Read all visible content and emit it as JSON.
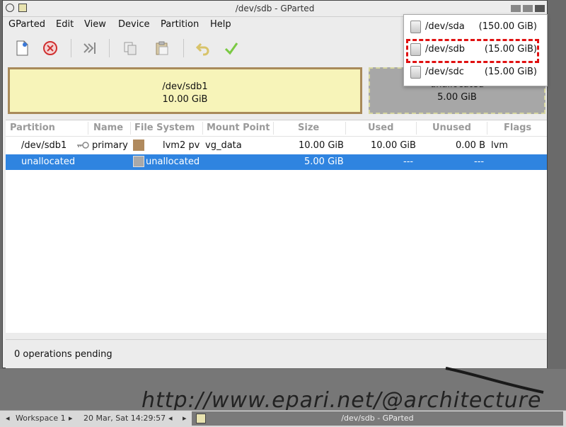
{
  "window": {
    "title": "/dev/sdb - GParted"
  },
  "menu": [
    "GParted",
    "Edit",
    "View",
    "Device",
    "Partition",
    "Help"
  ],
  "toolbar_icons": [
    "new-partition-icon",
    "delete-partition-icon",
    "resize-move-icon",
    "copy-icon",
    "paste-icon",
    "undo-icon",
    "apply-icon"
  ],
  "diskmap": {
    "part1_name": "/dev/sdb1",
    "part1_size": "10.00 GiB",
    "unalloc_name": "unallocated",
    "unalloc_size": "5.00 GiB"
  },
  "columns": [
    "Partition",
    "Name",
    "File System",
    "Mount Point",
    "Size",
    "Used",
    "Unused",
    "Flags"
  ],
  "rows": [
    {
      "partition": "/dev/sdb1",
      "name": "primary",
      "fs": "lvm2 pv",
      "mount": "vg_data",
      "size": "10.00 GiB",
      "used": "10.00 GiB",
      "unused": "0.00 B",
      "flags": "lvm",
      "color": "#b08a5e"
    },
    {
      "partition": "unallocated",
      "name": "",
      "fs": "unallocated",
      "mount": "",
      "size": "5.00 GiB",
      "used": "---",
      "unused": "---",
      "flags": "",
      "color": "#a9a9a9"
    }
  ],
  "status": "0 operations pending",
  "devices": [
    {
      "name": "/dev/sda",
      "size": "(150.00 GiB)"
    },
    {
      "name": "/dev/sdb",
      "size": "(15.00 GiB)"
    },
    {
      "name": "/dev/sdc",
      "size": "(15.00 GiB)"
    }
  ],
  "watermark": "http://www.epari.net/@architecture",
  "taskbar": {
    "workspace": "Workspace 1",
    "datetime": "20 Mar, Sat 14:29:57",
    "task": "/dev/sdb - GParted"
  },
  "colors": {
    "selection": "#2f84e0",
    "highlight": "#e01010",
    "lvm": "#b08a5e",
    "partition_fill": "#f7f4b9"
  }
}
